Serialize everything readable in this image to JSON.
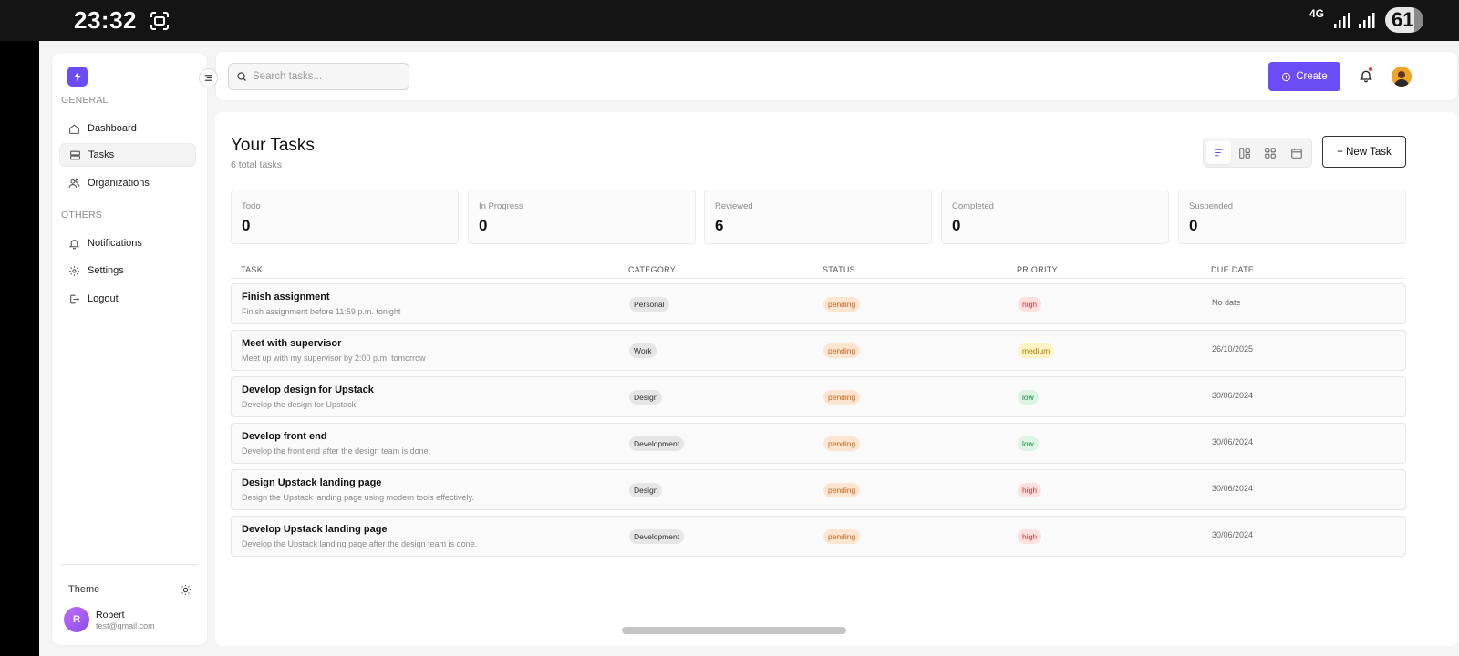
{
  "status_bar": {
    "time": "23:32",
    "network": "4G",
    "battery": "61"
  },
  "sidebar": {
    "general_label": "GENERAL",
    "others_label": "OTHERS",
    "items": [
      {
        "label": "Dashboard",
        "icon": "home-icon"
      },
      {
        "label": "Tasks",
        "icon": "tasks-icon",
        "active": true
      },
      {
        "label": "Organizations",
        "icon": "users-icon"
      }
    ],
    "others": [
      {
        "label": "Notifications",
        "icon": "bell-icon"
      },
      {
        "label": "Settings",
        "icon": "gear-icon"
      },
      {
        "label": "Logout",
        "icon": "logout-icon"
      }
    ],
    "theme_label": "Theme",
    "user": {
      "initial": "R",
      "name": "Robert",
      "email": "test@gmail.com"
    }
  },
  "header": {
    "search_placeholder": "Search tasks...",
    "create_label": "Create"
  },
  "main": {
    "title": "Your Tasks",
    "subtitle": "6 total tasks",
    "new_task_label": "+ New Task",
    "stats": [
      {
        "label": "Todo",
        "value": "0"
      },
      {
        "label": "In Progress",
        "value": "0"
      },
      {
        "label": "Reviewed",
        "value": "6"
      },
      {
        "label": "Completed",
        "value": "0"
      },
      {
        "label": "Suspended",
        "value": "0"
      }
    ],
    "columns": [
      "TASK",
      "CATEGORY",
      "STATUS",
      "PRIORITY",
      "DUE DATE"
    ],
    "tasks": [
      {
        "title": "Finish assignment",
        "desc": "Finish assignment before 11:59 p.m. tonight",
        "category": "Personal",
        "status": "pending",
        "priority": "high",
        "due": "No date"
      },
      {
        "title": "Meet with supervisor",
        "desc": "Meet up with my supervisor by 2:00 p.m. tomorrow",
        "category": "Work",
        "status": "pending",
        "priority": "medium",
        "due": "26/10/2025"
      },
      {
        "title": "Develop design for Upstack",
        "desc": "Develop the design for Upstack.",
        "category": "Design",
        "status": "pending",
        "priority": "low",
        "due": "30/06/2024"
      },
      {
        "title": "Develop front end",
        "desc": "Develop the front end after the design team is done.",
        "category": "Development",
        "status": "pending",
        "priority": "low",
        "due": "30/06/2024"
      },
      {
        "title": "Design Upstack landing page",
        "desc": "Design the Upstack landing page using modern tools effectively.",
        "category": "Design",
        "status": "pending",
        "priority": "high",
        "due": "30/06/2024"
      },
      {
        "title": "Develop Upstack landing page",
        "desc": "Develop the Upstack landing page after the design team is done.",
        "category": "Development",
        "status": "pending",
        "priority": "high",
        "due": "30/06/2024"
      }
    ]
  },
  "colors": {
    "accent": "#6c4cf5",
    "status_pending": "#c0631d",
    "priority_high": "#d0383a",
    "priority_medium": "#a67c05",
    "priority_low": "#1f8d47"
  }
}
